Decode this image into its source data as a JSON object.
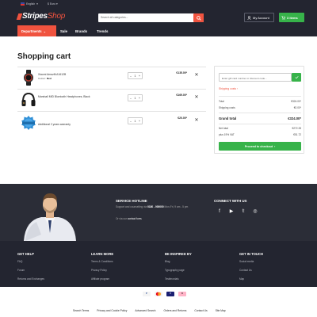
{
  "topbar": {
    "language": "English",
    "currency": "$ Euro"
  },
  "header": {
    "logo_main": "Stripes",
    "logo_accent": "Shop",
    "search_placeholder": "Search all categories...",
    "account_label": "My Account",
    "cart_label": "3 items"
  },
  "nav": {
    "departments_label": "Departments",
    "links": [
      "Sale",
      "Brands",
      "Trends"
    ]
  },
  "page_title": "Shopping cart",
  "cart": {
    "items": [
      {
        "name": "Xiaomi Amazfit A1612B",
        "color_label": "Colour:",
        "color_value": "Red",
        "quantity": "1",
        "price": "€135.00*"
      },
      {
        "name": "Marshall MID Bluetooth Headphones, Black",
        "quantity": "1",
        "price": "€169.00*"
      },
      {
        "name": "Additional 2 years warranty",
        "quantity": "1",
        "price": "€20.00*"
      }
    ]
  },
  "summary": {
    "gift_placeholder": "Enter gift card number or discount code...",
    "shipping_link": "Shipping costs",
    "rows": [
      {
        "label": "Total",
        "value": "€324.00*"
      },
      {
        "label": "Shipping costs",
        "value": "€0.00*"
      }
    ],
    "grand_total": {
      "label": "Grand total",
      "value": "€324.00*"
    },
    "tax_rows": [
      {
        "label": "Net total",
        "value": "€272.28"
      },
      {
        "label": "plus 19% VAT",
        "value": "€51.72"
      }
    ],
    "checkout_label": "Proceed to checkout"
  },
  "hotline": {
    "title": "SERVICE HOTLINE",
    "text_prefix": "Support and counselling via ",
    "phone": "0180 - 000000",
    "text_suffix": " Mon-Fri, 9 am - 5 pm",
    "mail_prefix": "Or via our ",
    "mail_link": "contact form."
  },
  "connect": {
    "title": "CONNECT WITH US",
    "icons": [
      "facebook-icon",
      "youtube-icon",
      "twitter-icon",
      "instagram-icon"
    ]
  },
  "footer": {
    "columns": [
      {
        "heading": "GET HELP",
        "links": [
          "FAQ",
          "Forum",
          "Returns and Exchanges"
        ]
      },
      {
        "heading": "LEARN MORE",
        "links": [
          "Terms & Conditions",
          "Privacy Policy",
          "Affiliate program"
        ]
      },
      {
        "heading": "BE INSPIRED BY",
        "links": [
          "Blog",
          "Typography page",
          "Testimonials"
        ]
      },
      {
        "heading": "GET IN TOUCH",
        "links": [
          "Social media",
          "Contact Us",
          "Map"
        ]
      }
    ]
  },
  "payments": [
    "PayPal",
    "Mastercard",
    "Visa",
    "Klarna"
  ],
  "bottom_links": [
    "Search Terms",
    "Privacy and Cookie Policy",
    "Advanced Search",
    "Orders and Returns",
    "Contact Us",
    "Site Map"
  ],
  "colors": {
    "brand": "#f0533f",
    "success": "#37b34a",
    "header_bg": "#232530",
    "band_bg": "#2b2d37"
  }
}
